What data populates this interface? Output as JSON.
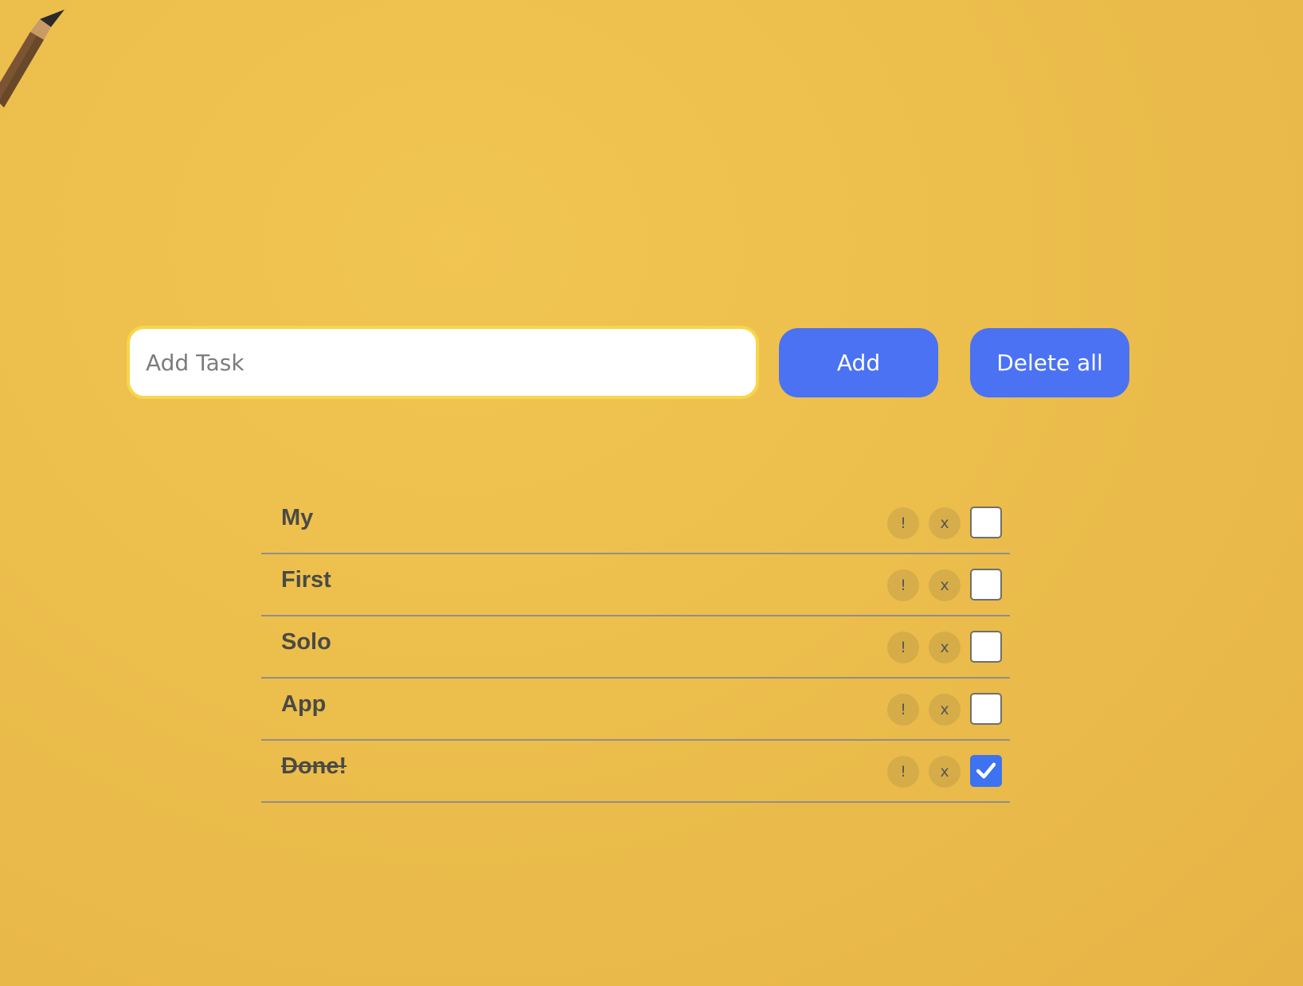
{
  "colors": {
    "background": "#ecbe4c",
    "accent": "#4a72f2",
    "input_border": "#f7d64a",
    "text": "#4a4a45"
  },
  "add_bar": {
    "input_value": "",
    "input_placeholder": "Add Task",
    "add_label": "Add",
    "delete_all_label": "Delete all"
  },
  "tasks": [
    {
      "label": "My",
      "important_label": "!",
      "remove_label": "x",
      "done": false
    },
    {
      "label": "First",
      "important_label": "!",
      "remove_label": "x",
      "done": false
    },
    {
      "label": "Solo",
      "important_label": "!",
      "remove_label": "x",
      "done": false
    },
    {
      "label": "App",
      "important_label": "!",
      "remove_label": "x",
      "done": false
    },
    {
      "label": "Done!",
      "important_label": "!",
      "remove_label": "x",
      "done": true
    }
  ]
}
